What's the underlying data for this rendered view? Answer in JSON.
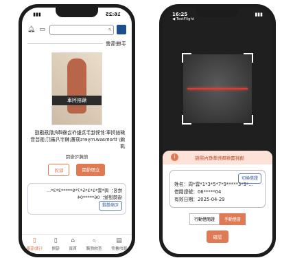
{
  "left": {
    "status_time": "16:25",
    "section_title": "手機借書",
    "book_title": "解剖列車",
    "description": "解剖列車:針對徒手及動作治療師的肌筋膜經線/ thomasw.myers原著;賴宇凡審訂;張芸音譯",
    "status_text": "館藏可借閱",
    "btn_cancel": "取消",
    "btn_borrow": "立即借閱",
    "card_chip": "切換借證",
    "card_name": "姓名：周*雲*1*3*5*7*9*****3*3*...",
    "card_id": "借閱證號：06*****04",
    "tabs": [
      "行動借還",
      "借閱",
      "首頁",
      "查詢館藏",
      "我的書房"
    ]
  },
  "right": {
    "status_time": "16:25",
    "status_sub": "◀ TestFlight",
    "sheet_message": "請將書條碼對準框內掃描",
    "chip": "切換借證",
    "name": "姓名：周*雲*1*3*5*7*9*****3*3*...",
    "card_no": "借閱證號：06*****04",
    "due_date": "有效日期：2025-04-29",
    "toggle_left": "行動借閱證",
    "toggle_right": "手動借書",
    "confirm": "確認"
  }
}
